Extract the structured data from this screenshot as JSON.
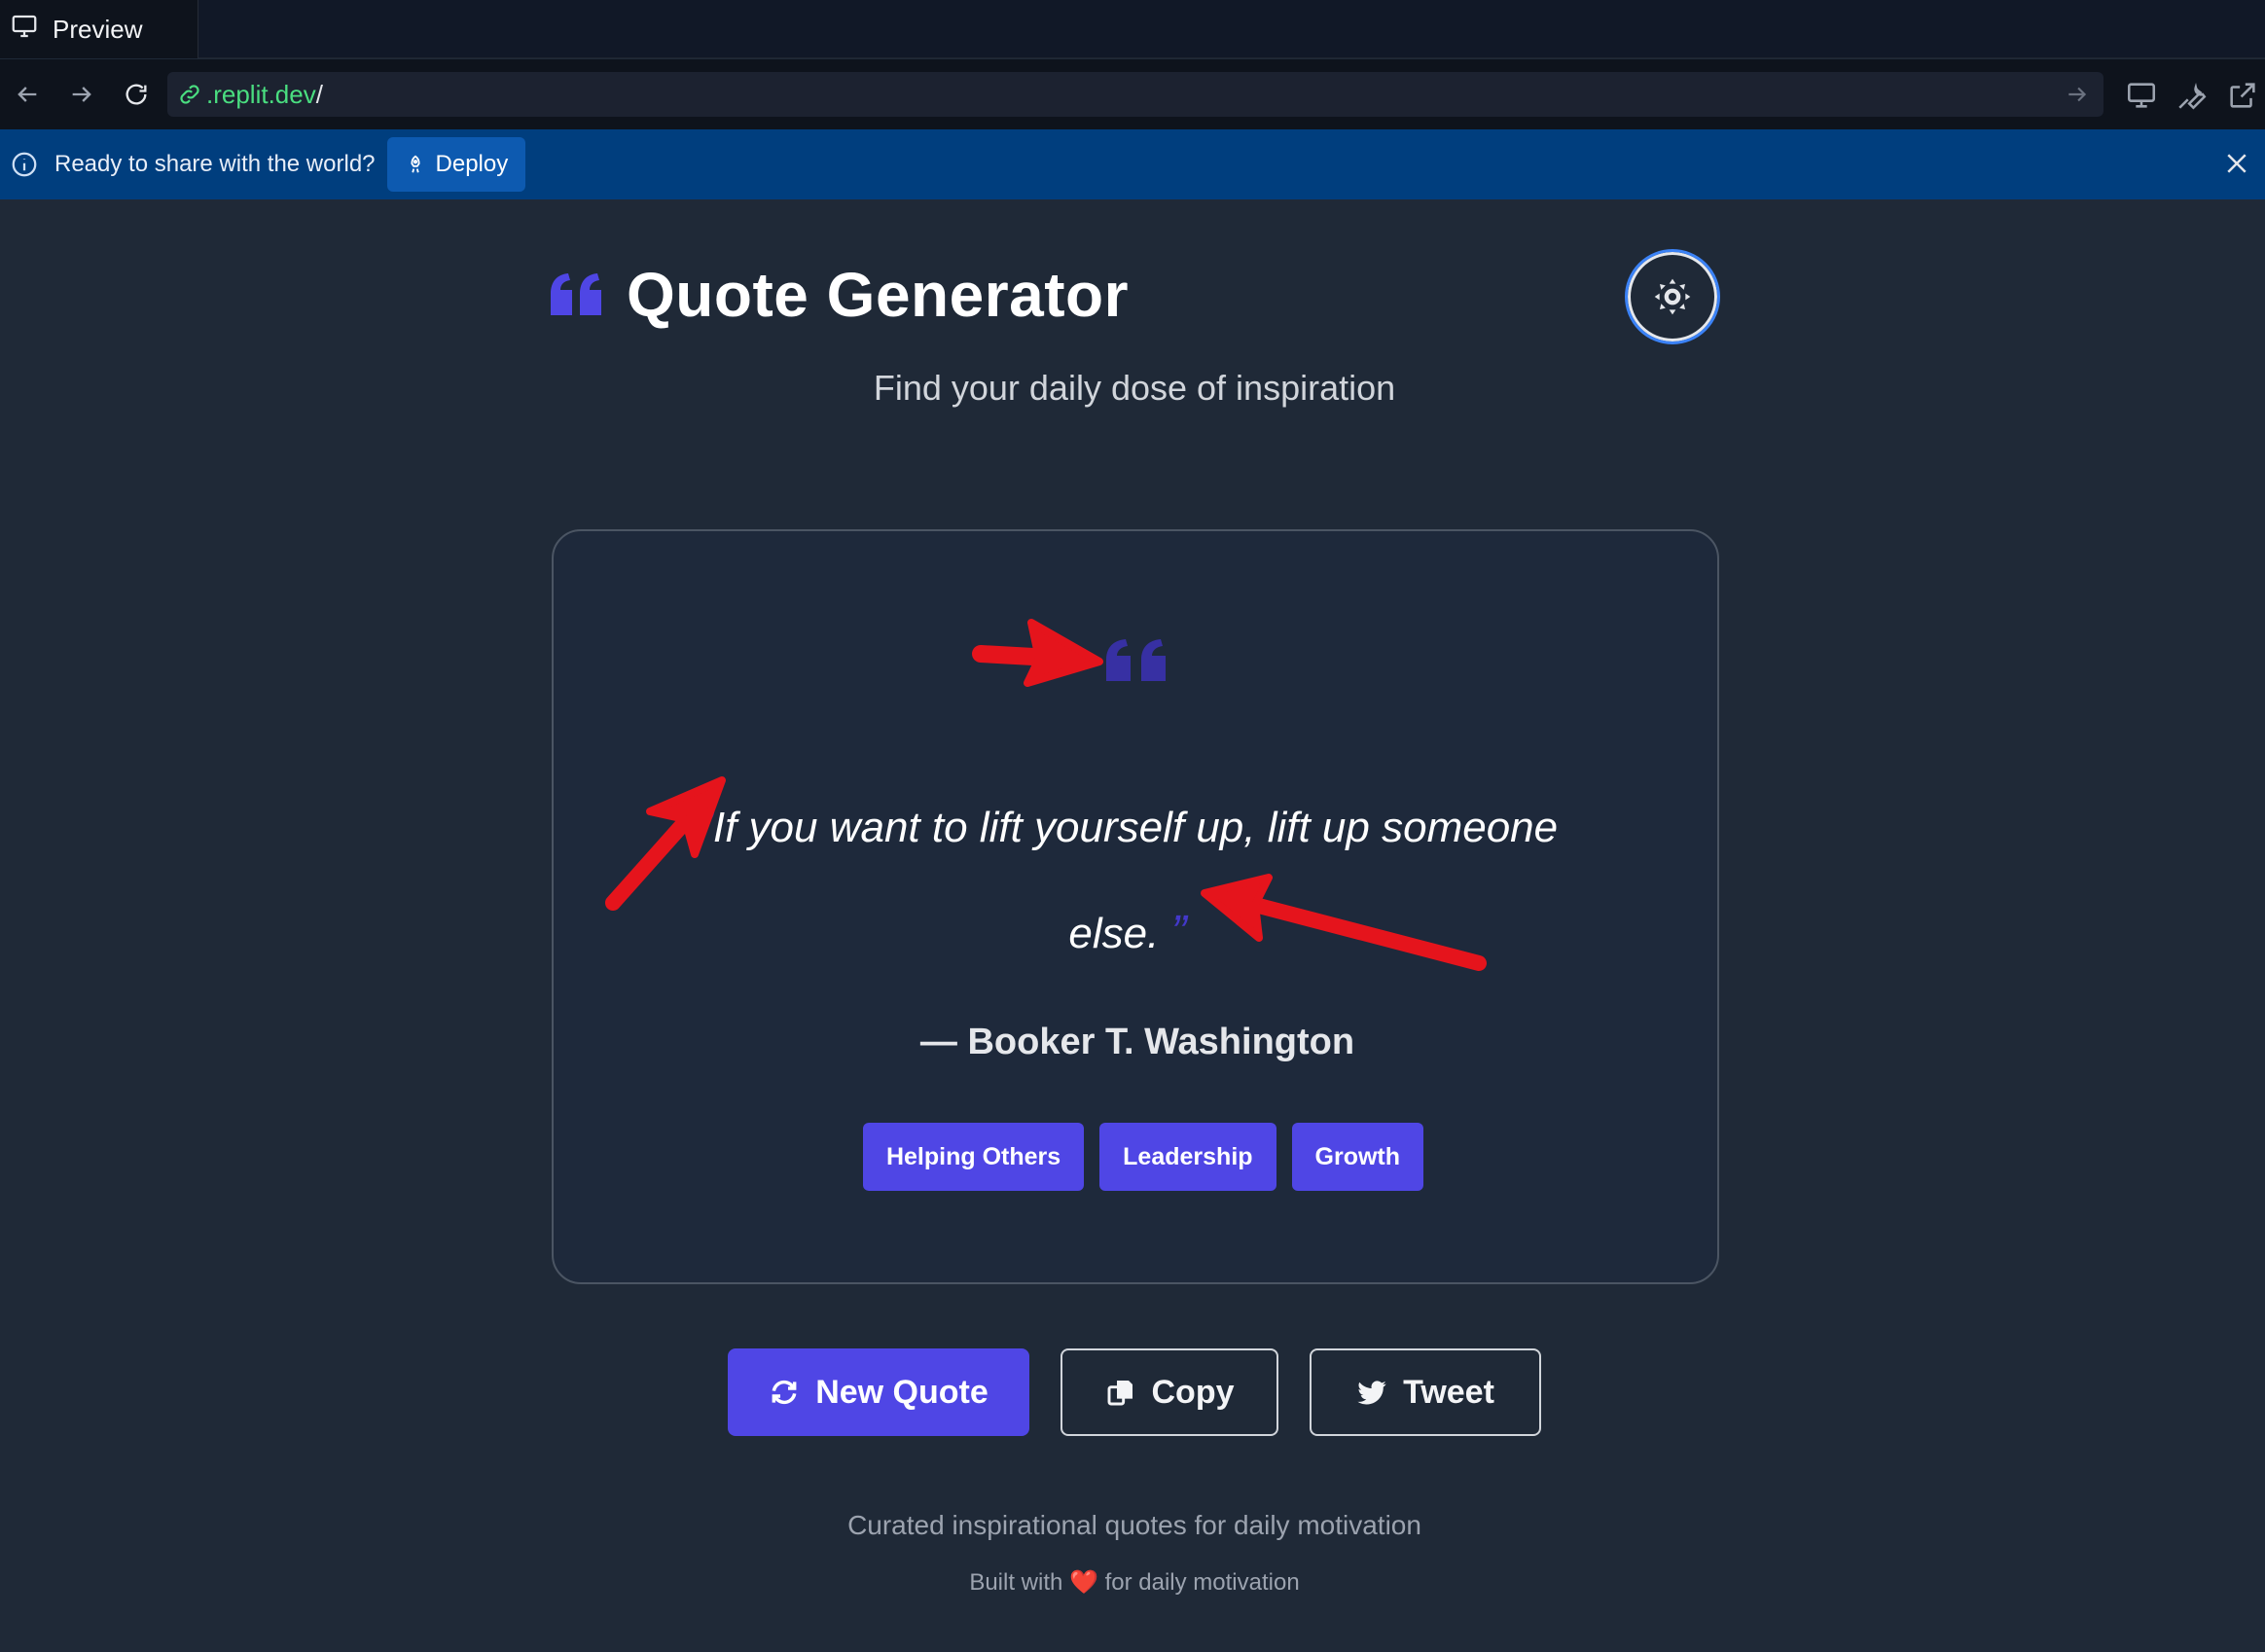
{
  "browser": {
    "tab_label": "Preview",
    "url_domain": ".replit.dev",
    "url_path": "/"
  },
  "banner": {
    "message": "Ready to share with the world?",
    "deploy_label": "Deploy"
  },
  "app": {
    "title": "Quote Generator",
    "subtitle": "Find your daily dose of inspiration"
  },
  "quote": {
    "open_mark": "”",
    "text": "If you want to lift yourself up, lift up someone else.",
    "close_mark": "”",
    "author": "— Booker T. Washington",
    "tags": [
      "Helping Others",
      "Leadership",
      "Growth"
    ]
  },
  "actions": {
    "new_quote": "New Quote",
    "copy": "Copy",
    "tweet": "Tweet"
  },
  "footer": {
    "tagline": "Curated inspirational quotes for daily motivation",
    "built_prefix": "Built with",
    "heart": "❤️",
    "built_suffix": "for daily motivation"
  },
  "colors": {
    "accent": "#4f46e5",
    "background": "#1f2937",
    "banner": "#003e7e",
    "annotation": "#e5141c"
  }
}
